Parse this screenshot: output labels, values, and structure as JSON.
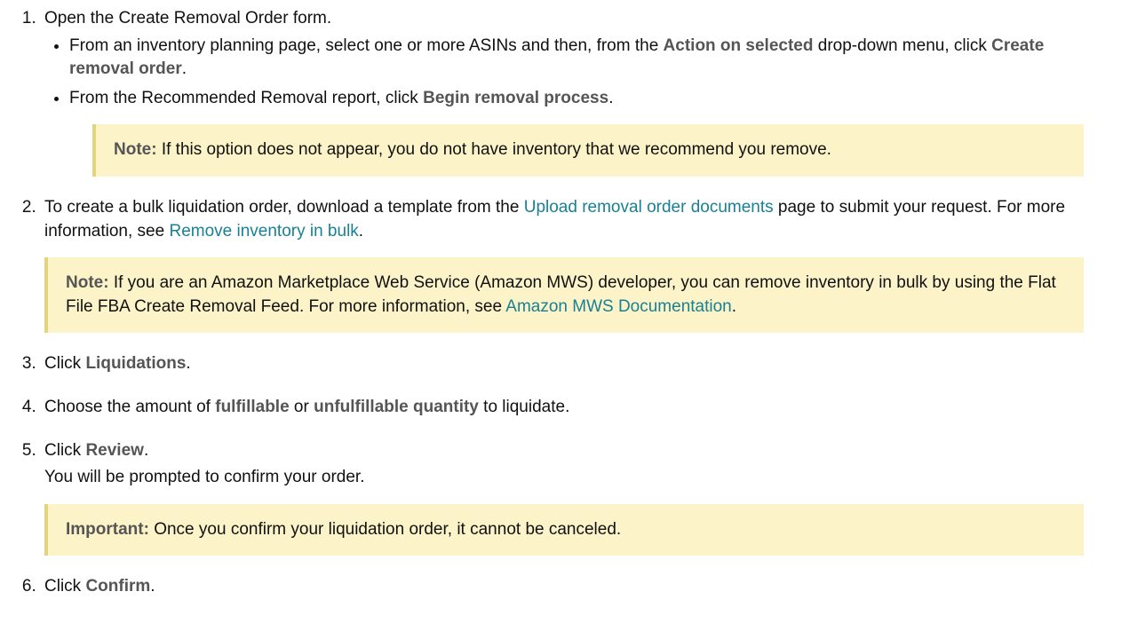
{
  "step1": {
    "text": "Open the Create Removal Order form.",
    "bullet1_a": "From an inventory planning page, select one or more ASINs and then, from the ",
    "bullet1_b": "Action on selected",
    "bullet1_c": " drop-down menu, click ",
    "bullet1_d": "Create removal order",
    "bullet1_e": ".",
    "bullet2_a": "From the Recommended Removal report, click ",
    "bullet2_b": "Begin removal process",
    "bullet2_c": ".",
    "note_label": "Note:",
    "note_text": " If this option does not appear, you do not have inventory that we recommend you remove."
  },
  "step2": {
    "a": "To create a bulk liquidation order, download a template from the ",
    "link1": "Upload removal order documents",
    "b": " page to submit your request. For more information, see ",
    "link2": "Remove inventory in bulk",
    "c": ".",
    "note_label": "Note:",
    "note_a": " If you are an Amazon Marketplace Web Service (Amazon MWS) developer, you can remove inventory in bulk by using the Flat File FBA Create Removal Feed. For more information, see ",
    "note_link": "Amazon MWS Documentation",
    "note_b": "."
  },
  "step3": {
    "a": "Click ",
    "b": "Liquidations",
    "c": "."
  },
  "step4": {
    "a": "Choose the amount of ",
    "b": "fulfillable",
    "c": " or ",
    "d": "unfulfillable quantity",
    "e": " to liquidate."
  },
  "step5": {
    "a": "Click ",
    "b": "Review",
    "c": ".",
    "after": "You will be prompted to confirm your order.",
    "imp_label": "Important:",
    "imp_text": " Once you confirm your liquidation order, it cannot be canceled."
  },
  "step6": {
    "a": "Click ",
    "b": "Confirm",
    "c": "."
  }
}
